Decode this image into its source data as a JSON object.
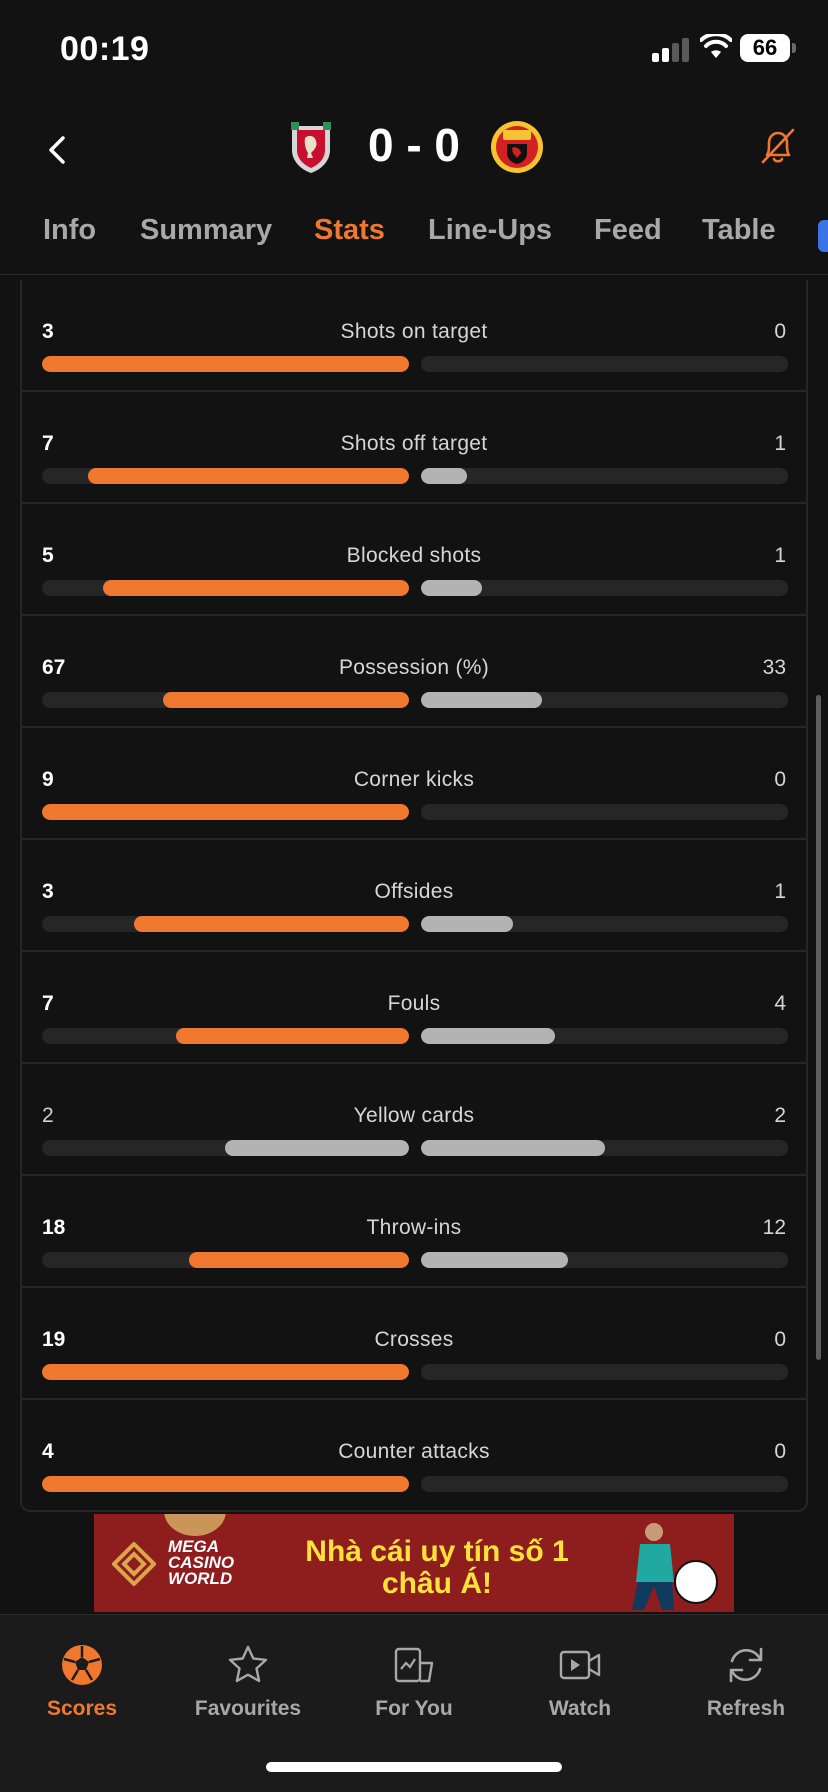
{
  "status_bar": {
    "time": "00:19",
    "battery": "66"
  },
  "match": {
    "score": "0 - 0",
    "home_team_icon": "liverpool-crest-icon",
    "away_team_icon": "man-united-crest-icon"
  },
  "tabs": [
    "Info",
    "Summary",
    "Stats",
    "Line-Ups",
    "Feed",
    "Table"
  ],
  "active_tab": "Stats",
  "colors": {
    "accent": "#f0782e",
    "away_bar": "#b3b3b3",
    "track": "#262626",
    "background": "#121212"
  },
  "stats": [
    {
      "label": "Shots on target",
      "home": "3",
      "away": "0",
      "home_share": 1.0,
      "away_share": 0.0,
      "home_bold": true
    },
    {
      "label": "Shots off target",
      "home": "7",
      "away": "1",
      "home_share": 0.875,
      "away_share": 0.125,
      "home_bold": true
    },
    {
      "label": "Blocked shots",
      "home": "5",
      "away": "1",
      "home_share": 0.833,
      "away_share": 0.167,
      "home_bold": true
    },
    {
      "label": "Possession (%)",
      "home": "67",
      "away": "33",
      "home_share": 0.67,
      "away_share": 0.33,
      "home_bold": true
    },
    {
      "label": "Corner kicks",
      "home": "9",
      "away": "0",
      "home_share": 1.0,
      "away_share": 0.0,
      "home_bold": true
    },
    {
      "label": "Offsides",
      "home": "3",
      "away": "1",
      "home_share": 0.75,
      "away_share": 0.25,
      "home_bold": true
    },
    {
      "label": "Fouls",
      "home": "7",
      "away": "4",
      "home_share": 0.636,
      "away_share": 0.364,
      "home_bold": true
    },
    {
      "label": "Yellow cards",
      "home": "2",
      "away": "2",
      "home_share": 0.5,
      "away_share": 0.5,
      "home_bold": false
    },
    {
      "label": "Throw-ins",
      "home": "18",
      "away": "12",
      "home_share": 0.6,
      "away_share": 0.4,
      "home_bold": true
    },
    {
      "label": "Crosses",
      "home": "19",
      "away": "0",
      "home_share": 1.0,
      "away_share": 0.0,
      "home_bold": true
    },
    {
      "label": "Counter attacks",
      "home": "4",
      "away": "0",
      "home_share": 1.0,
      "away_share": 0.0,
      "home_bold": true
    }
  ],
  "ad": {
    "brand": "MEGA CASINO WORLD",
    "headline": "Nhà cái uy tín số 1 châu Á!"
  },
  "bottom_nav": [
    {
      "label": "Scores",
      "icon": "soccer-ball-icon",
      "active": true
    },
    {
      "label": "Favourites",
      "icon": "star-icon",
      "active": false
    },
    {
      "label": "For You",
      "icon": "for-you-icon",
      "active": false
    },
    {
      "label": "Watch",
      "icon": "video-icon",
      "active": false
    },
    {
      "label": "Refresh",
      "icon": "refresh-icon",
      "active": false
    }
  ]
}
